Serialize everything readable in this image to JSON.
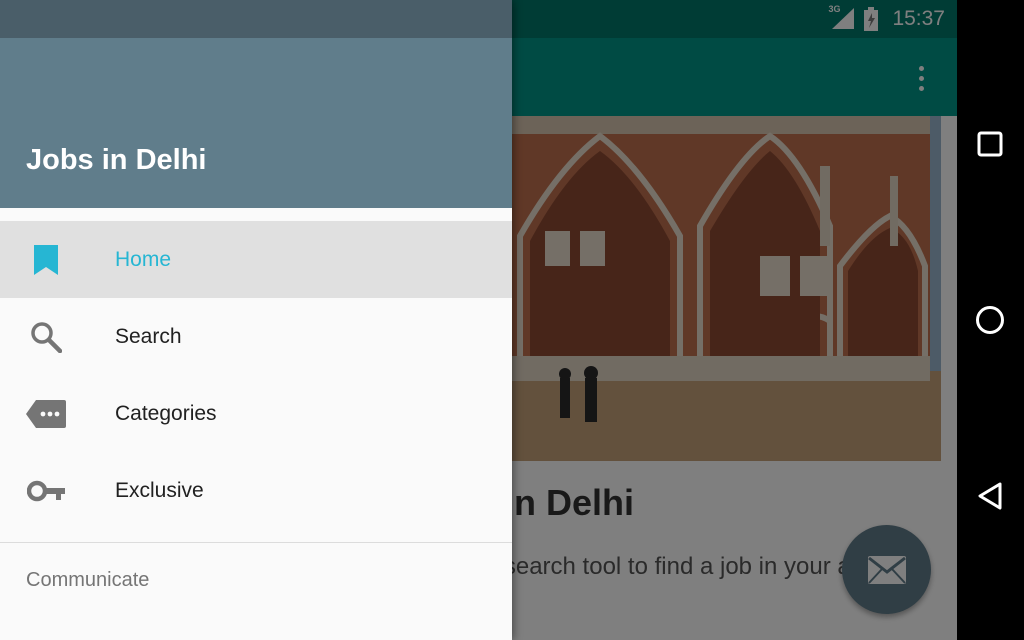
{
  "status_bar": {
    "network": "3G",
    "time": "15:37"
  },
  "app": {
    "card_title": "Jobs in Delhi",
    "card_body": "Your job search tool to find a job in your area."
  },
  "drawer": {
    "title": "Jobs in Delhi",
    "items": [
      {
        "label": "Home",
        "icon": "bookmark-icon",
        "active": true
      },
      {
        "label": "Search",
        "icon": "search-icon",
        "active": false
      },
      {
        "label": "Categories",
        "icon": "label-more-icon",
        "active": false
      },
      {
        "label": "Exclusive",
        "icon": "key-icon",
        "active": false
      }
    ],
    "section_header": "Communicate"
  },
  "colors": {
    "accent": "#26b6d3",
    "drawer_header": "#607d8b",
    "app_bar": "#009688",
    "fab": "#607d8b"
  },
  "fab": {
    "icon": "mail-icon"
  },
  "system_nav": {
    "icons": [
      "recents-icon",
      "home-circle-icon",
      "back-icon"
    ]
  }
}
